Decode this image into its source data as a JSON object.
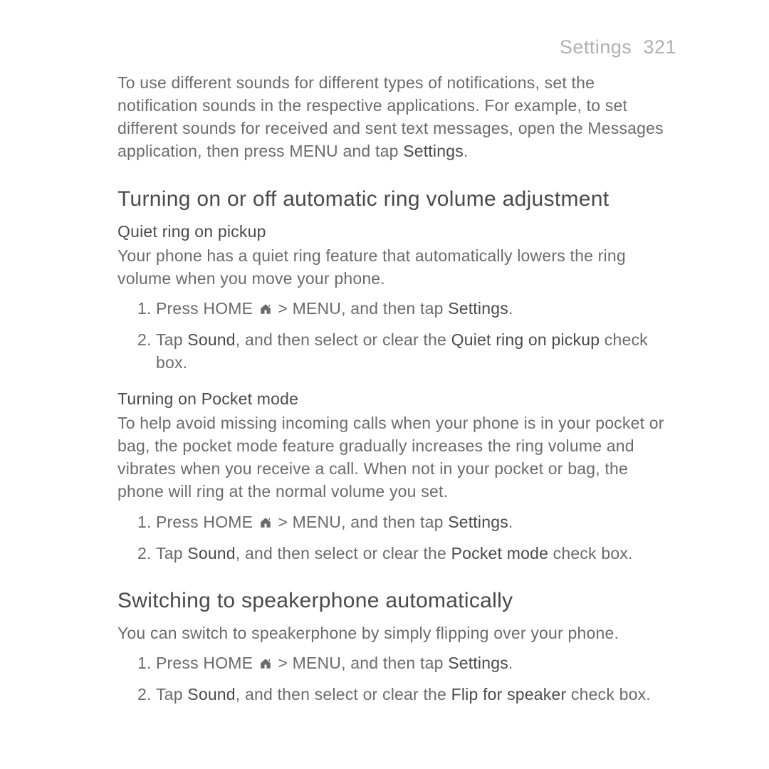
{
  "header": {
    "section": "Settings",
    "page": "321"
  },
  "intro": {
    "text_before": "To use different sounds for different types of notifications, set the notification sounds in the respective applications. For example, to set different sounds for received and sent text messages, open the Messages application, then press MENU and tap ",
    "strong": "Settings",
    "text_after": "."
  },
  "section1": {
    "title": "Turning on or off automatic ring volume adjustment",
    "sub1": {
      "title": "Quiet ring on pickup",
      "para": "Your phone has a quiet ring feature that automatically lowers the ring volume when you move your phone.",
      "step1_a": "Press HOME ",
      "step1_b": " > MENU, and then tap ",
      "step1_strong": "Settings",
      "step1_c": ".",
      "step2_a": "Tap ",
      "step2_strong1": "Sound",
      "step2_b": ", and then select or clear the ",
      "step2_strong2": "Quiet ring on pickup",
      "step2_c": " check box."
    },
    "sub2": {
      "title": "Turning on Pocket mode",
      "para": "To help avoid missing incoming calls when your phone is in your pocket or bag, the pocket mode feature gradually increases the ring volume and vibrates when you receive a call. When not in your pocket or bag, the phone will ring at the normal volume you set.",
      "step1_a": "Press HOME ",
      "step1_b": " > MENU, and then tap ",
      "step1_strong": "Settings",
      "step1_c": ".",
      "step2_a": "Tap ",
      "step2_strong1": "Sound",
      "step2_b": ", and then select or clear the ",
      "step2_strong2": "Pocket mode",
      "step2_c": " check box."
    }
  },
  "section2": {
    "title": "Switching to speakerphone automatically",
    "para": "You can switch to speakerphone by simply flipping over your phone.",
    "step1_a": "Press HOME ",
    "step1_b": " > MENU, and then tap ",
    "step1_strong": "Settings",
    "step1_c": ".",
    "step2_a": "Tap ",
    "step2_strong1": "Sound",
    "step2_b": ", and then select or clear the ",
    "step2_strong2": "Flip for speaker",
    "step2_c": " check box."
  }
}
